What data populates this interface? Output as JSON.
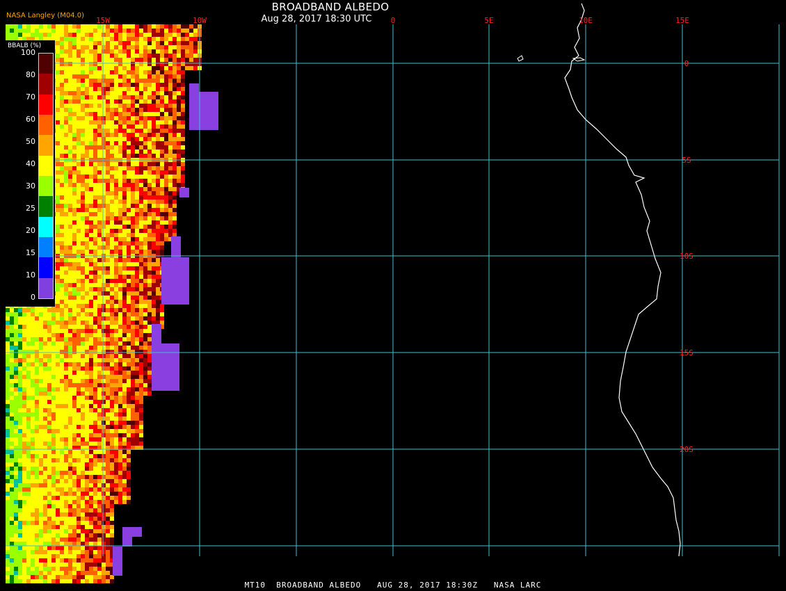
{
  "header": {
    "title": "BROADBAND ALBEDO",
    "subtitle": "Aug 28, 2017 18:30 UTC",
    "producer": "NASA Langley (M04.0)"
  },
  "footer": {
    "text": "MT10  BROADBAND ALBEDO   AUG 28, 2017 18:30Z   NASA LARC"
  },
  "legend": {
    "label": "BBALB (%)",
    "ticks": [
      "100",
      "80",
      "70",
      "60",
      "50",
      "40",
      "30",
      "25",
      "20",
      "15",
      "10",
      "0"
    ],
    "colors": [
      "#500000",
      "#a00000",
      "#ff0000",
      "#ff6000",
      "#ffa500",
      "#ffff00",
      "#9aff00",
      "#008000",
      "#00ffff",
      "#0080ff",
      "#0000ff",
      "#8040e0"
    ]
  },
  "grid": {
    "longitude_labels": [
      "15W",
      "10W",
      "0",
      "5E",
      "10E",
      "15E"
    ],
    "latitude_labels": [
      "0",
      "5S",
      "10S",
      "15S",
      "20S"
    ],
    "grid_color": "#40c0d0",
    "label_color": "#ff2020"
  },
  "colors": {
    "background": "#000000",
    "coastline": "#ffffff",
    "no_data": "#8a3fe0"
  }
}
